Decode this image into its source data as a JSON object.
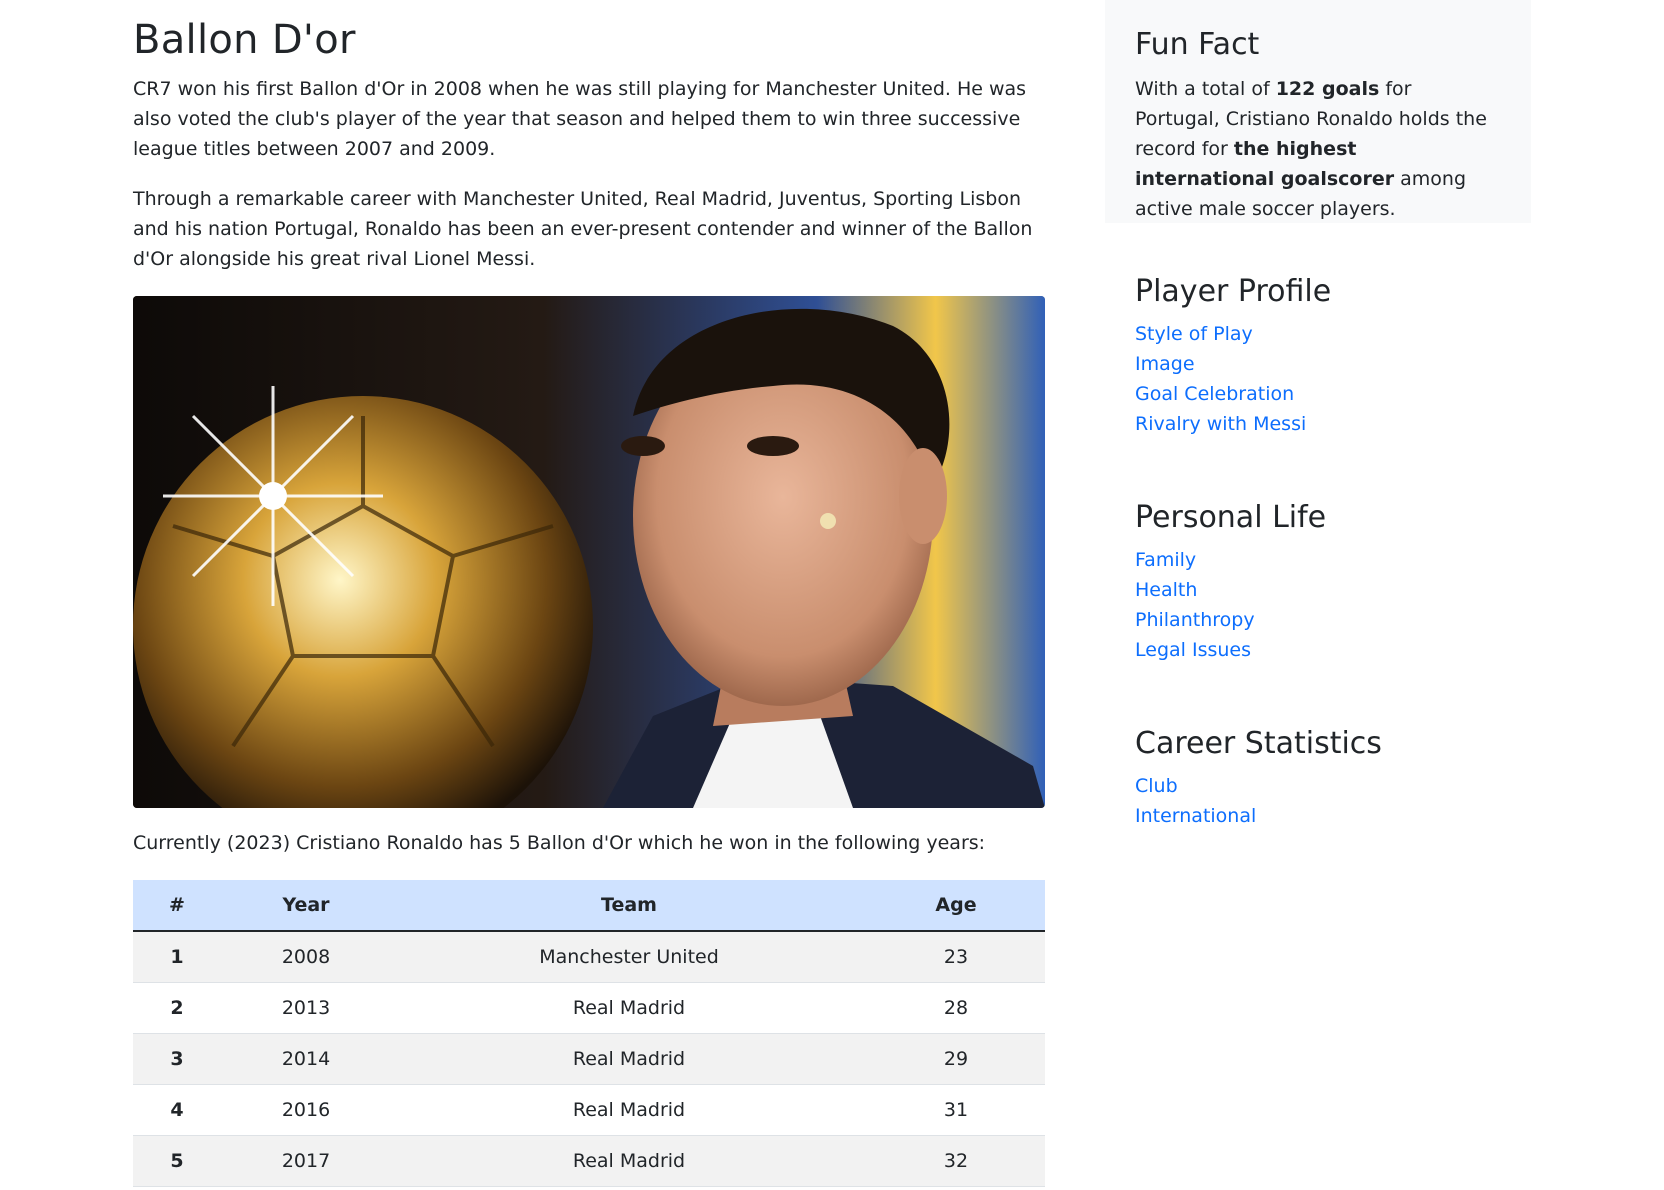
{
  "article": {
    "title": "Ballon D'or",
    "paragraph1": "CR7 won his first Ballon d'Or in 2008 when he was still playing for Manchester United. He was also voted the club's player of the year that season and helped them to win three successive league titles between 2007 and 2009.",
    "paragraph2": "Through a remarkable career with Manchester United, Real Madrid, Juventus, Sporting Lisbon and his nation Portugal, Ronaldo has been an ever-present contender and winner of the Ballon d'Or alongside his great rival Lionel Messi.",
    "intro_line": "Currently (2023) Cristiano Ronaldo has 5 Ballon d'Or which he won in the following years:"
  },
  "table": {
    "headers": {
      "num": "#",
      "year": "Year",
      "team": "Team",
      "age": "Age"
    },
    "rows": [
      {
        "num": "1",
        "year": "2008",
        "team": "Manchester United",
        "age": "23"
      },
      {
        "num": "2",
        "year": "2013",
        "team": "Real Madrid",
        "age": "28"
      },
      {
        "num": "3",
        "year": "2014",
        "team": "Real Madrid",
        "age": "29"
      },
      {
        "num": "4",
        "year": "2016",
        "team": "Real Madrid",
        "age": "31"
      },
      {
        "num": "5",
        "year": "2017",
        "team": "Real Madrid",
        "age": "32"
      }
    ]
  },
  "fun_fact": {
    "title": "Fun Fact",
    "text_1": "With a total of ",
    "bold_1": "122 goals",
    "text_2": " for Portugal, Cristiano Ronaldo holds the record for ",
    "bold_2": "the highest international goalscorer",
    "text_3": " among active male soccer players."
  },
  "sidebar": {
    "player_profile": {
      "title": "Player Profile",
      "links": [
        "Style of Play",
        "Image",
        "Goal Celebration",
        "Rivalry with Messi"
      ]
    },
    "personal_life": {
      "title": "Personal Life",
      "links": [
        "Family",
        "Health",
        "Philanthropy",
        "Legal Issues"
      ]
    },
    "career_statistics": {
      "title": "Career Statistics",
      "links": [
        "Club",
        "International"
      ]
    }
  },
  "colors": {
    "link": "#0d6efd",
    "table_header_bg": "#cfe2ff",
    "fun_fact_bg": "#f8f9fa"
  }
}
